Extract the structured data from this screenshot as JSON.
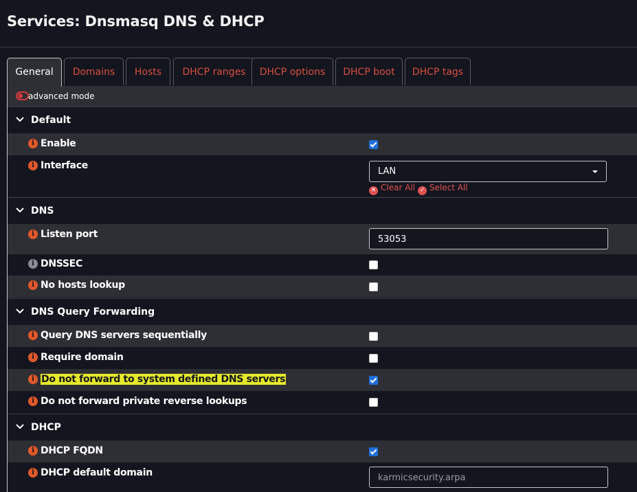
{
  "page": {
    "title": "Services: Dnsmasq DNS & DHCP"
  },
  "tabs": [
    {
      "label": "General"
    },
    {
      "label": "Domains"
    },
    {
      "label": "Hosts"
    },
    {
      "label": "DHCP ranges"
    },
    {
      "label": "DHCP options"
    },
    {
      "label": "DHCP boot"
    },
    {
      "label": "DHCP tags"
    }
  ],
  "advanced_mode": {
    "label": "advanced mode",
    "enabled": false
  },
  "sections": {
    "default": {
      "title": "Default",
      "enable": {
        "label": "Enable",
        "checked": true
      },
      "interface": {
        "label": "Interface",
        "selected": "LAN",
        "clear_all": "Clear All",
        "select_all": "Select All"
      }
    },
    "dns": {
      "title": "DNS",
      "listen_port": {
        "label": "Listen port",
        "value": "53053"
      },
      "dnssec": {
        "label": "DNSSEC",
        "checked": false
      },
      "no_hosts_lookup": {
        "label": "No hosts lookup",
        "checked": false
      }
    },
    "dns_query_forwarding": {
      "title": "DNS Query Forwarding",
      "query_sequentially": {
        "label": "Query DNS servers sequentially",
        "checked": false
      },
      "require_domain": {
        "label": "Require domain",
        "checked": false
      },
      "no_system_dns": {
        "label": "Do not forward to system defined DNS servers",
        "checked": true
      },
      "no_private_reverse": {
        "label": "Do not forward private reverse lookups",
        "checked": false
      }
    },
    "dhcp": {
      "title": "DHCP",
      "dhcp_fqdn": {
        "label": "DHCP FQDN",
        "checked": true
      },
      "default_domain": {
        "label": "DHCP default domain",
        "placeholder": "karmicsecurity.arpa"
      }
    }
  },
  "icons": {
    "info_icon": "info-circle",
    "section_chevron": "chevron-down",
    "clear_icon": "x-circle",
    "select_icon": "check-circle"
  },
  "colors": {
    "background": "#13151f",
    "row_alt": "#2e2f35",
    "accent_red": "#d94f3d",
    "info_orange": "#e0582a",
    "checkbox_blue": "#1e6fd9",
    "highlight_yellow": "#e5e82a"
  }
}
